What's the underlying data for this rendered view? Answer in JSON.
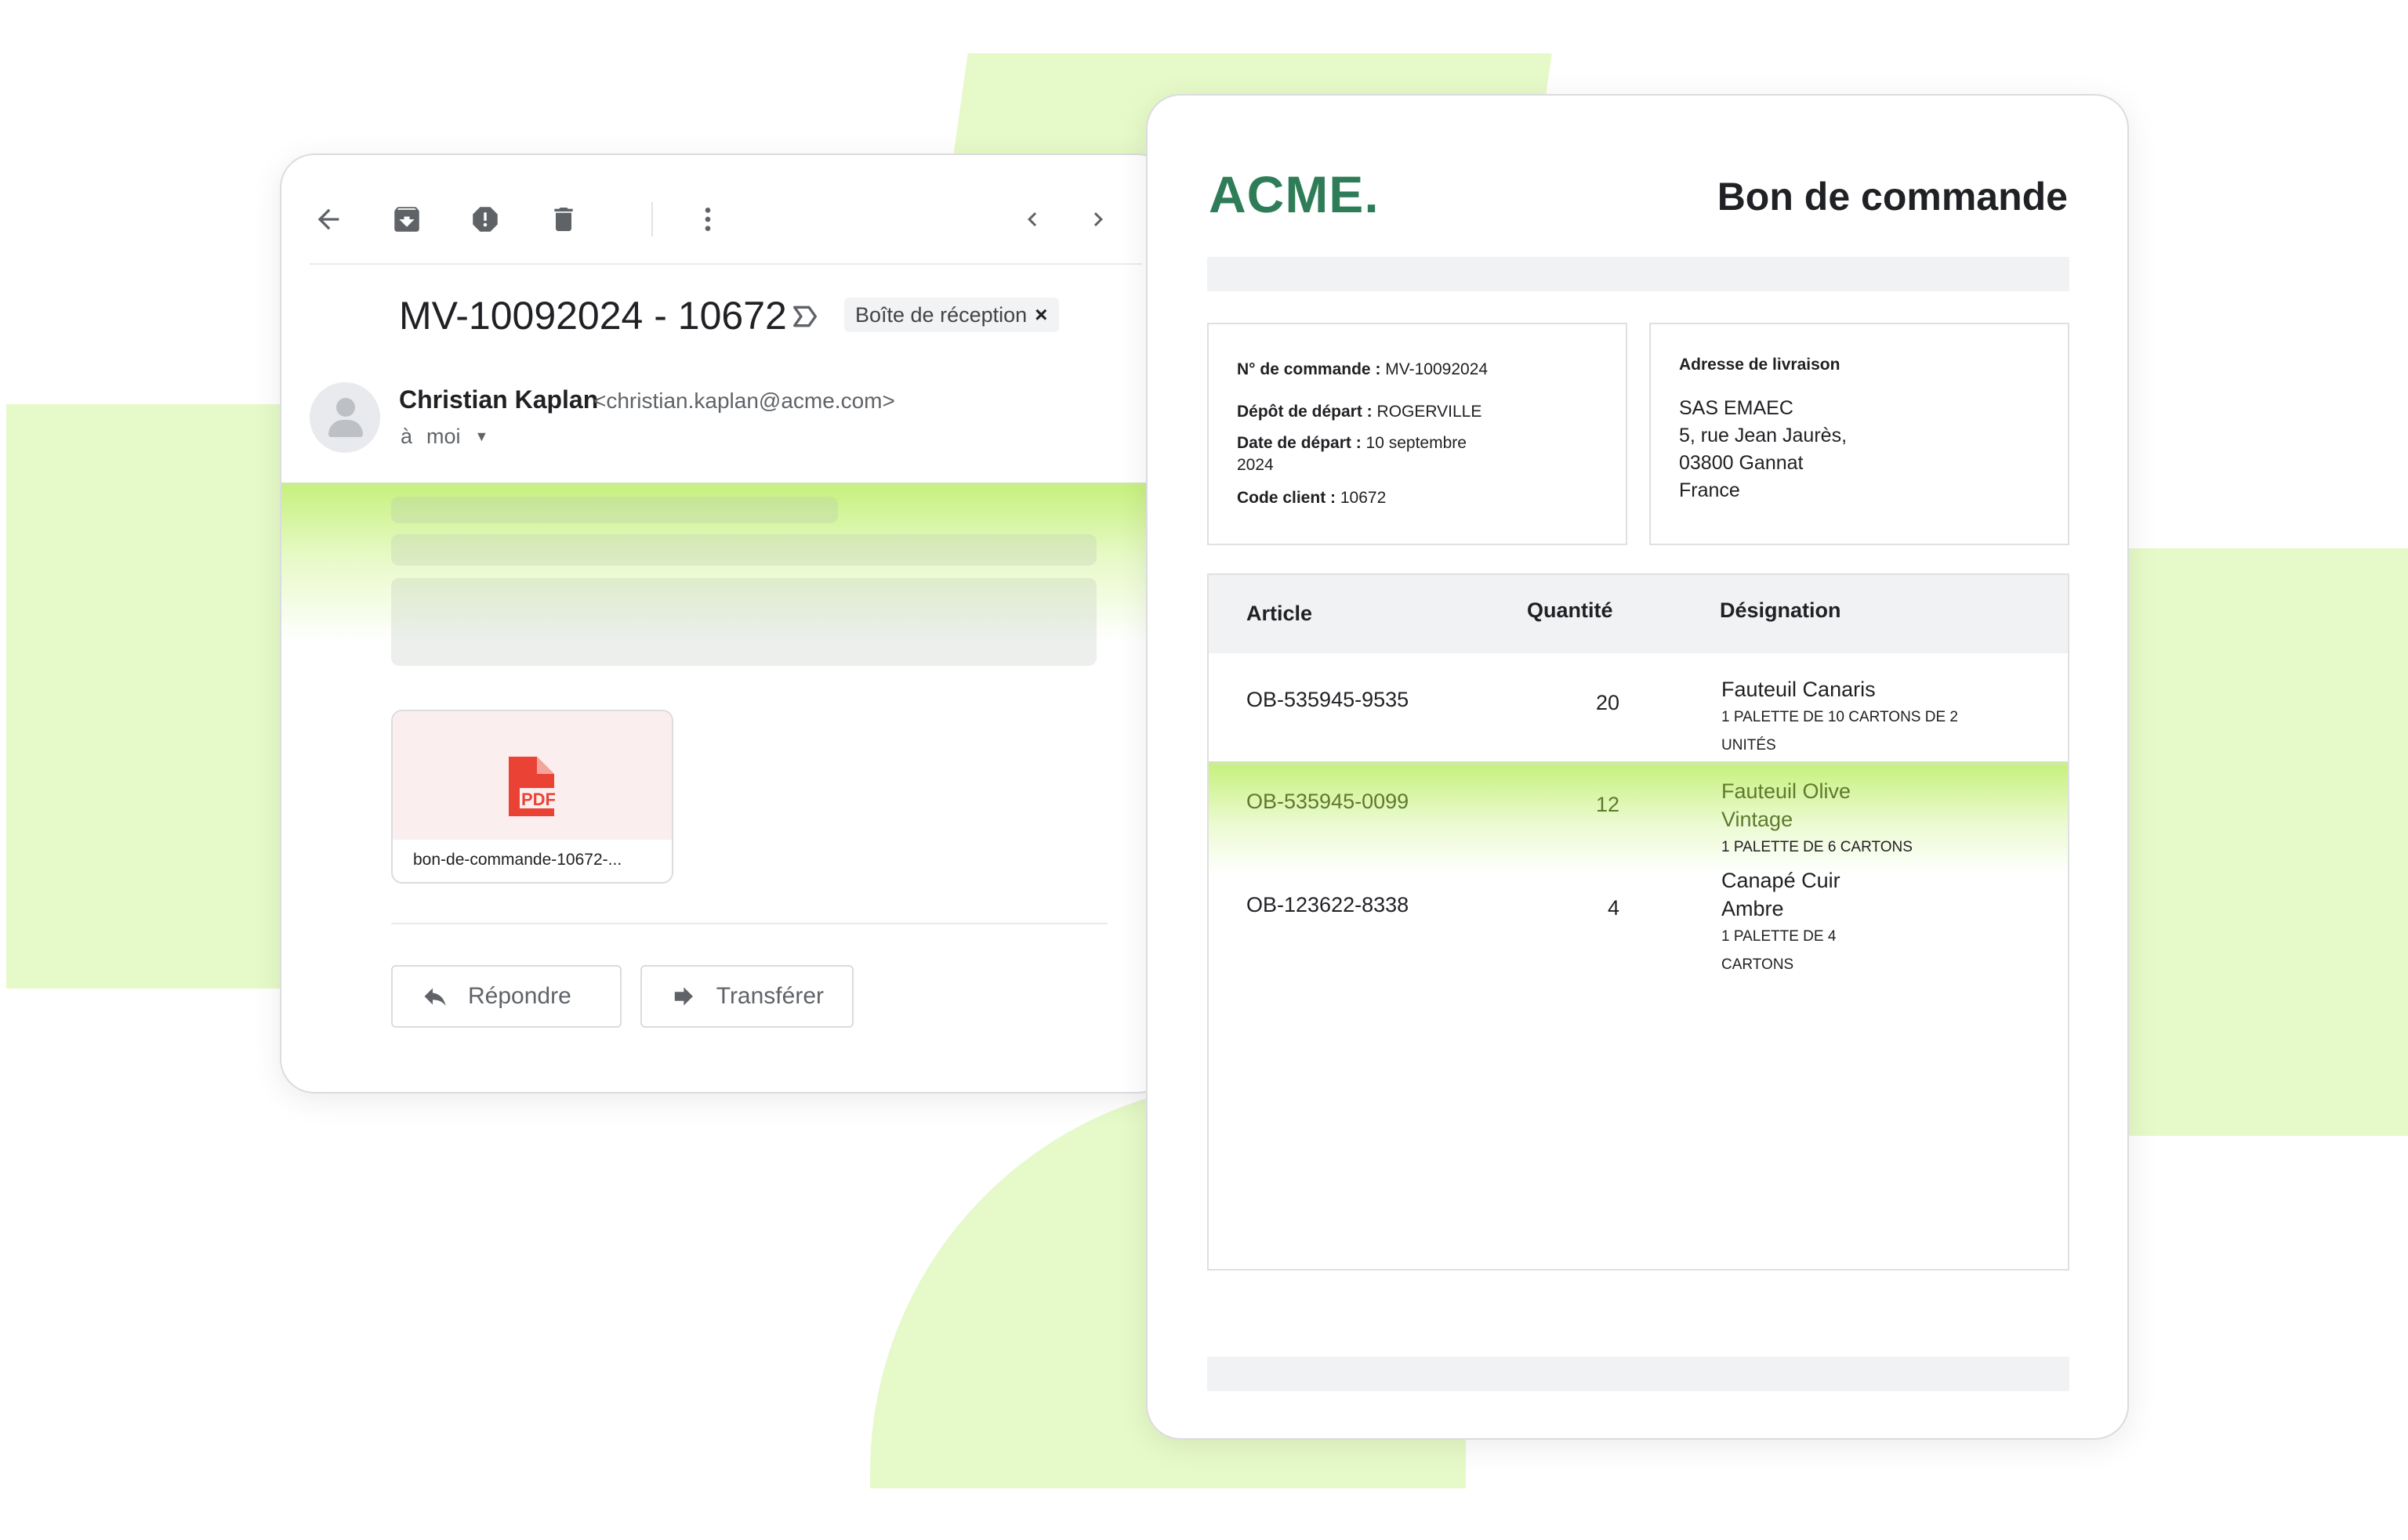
{
  "email": {
    "toolbar": {
      "back_icon": "arrow-left-icon",
      "archive_icon": "archive-icon",
      "spam_icon": "report-spam-icon",
      "delete_icon": "trash-icon",
      "more_icon": "more-vert-icon",
      "prev_icon": "chevron-left-icon",
      "next_icon": "chevron-right-icon"
    },
    "subject": "MV-10092024 - 10672",
    "label_chip": "Boîte de réception",
    "label_chip_close": "×",
    "sender": {
      "name": "Christian Kaplan",
      "email": "<christian.kaplan@acme.com>",
      "to_prefix": "à",
      "to_value": "moi"
    },
    "attachment": {
      "type_label": "PDF",
      "filename": "bon-de-commande-10672-..."
    },
    "actions": {
      "reply": "Répondre",
      "forward": "Transférer"
    }
  },
  "document": {
    "logo": "ACME.",
    "title": "Bon de commande",
    "order_info": {
      "order_number_label": "N° de commande :",
      "order_number": "MV-10092024",
      "depot_label": "Dépôt de départ :",
      "depot": "ROGERVILLE",
      "date_label": "Date de départ :",
      "date_line1": "10 septembre",
      "date_line2": "2024",
      "client_label": "Code client :",
      "client": "10672"
    },
    "delivery": {
      "title": "Adresse de livraison",
      "line1": "SAS EMAEC",
      "line2": "5, rue Jean Jaurès,",
      "line3": "03800 Gannat",
      "line4": "France"
    },
    "table": {
      "headers": {
        "article": "Article",
        "quantity": "Quantité",
        "designation": "Désignation"
      },
      "rows": [
        {
          "article": "OB-535945-9535",
          "quantity": "20",
          "name": "Fauteuil Canaris",
          "name2": "",
          "detail1": "1 PALETTE DE 10 CARTONS DE 2",
          "detail2": "UNITÉS"
        },
        {
          "article": "OB-535945-0099",
          "quantity": "12",
          "name": "Fauteuil Olive",
          "name2": "Vintage",
          "detail1": "1 PALETTE DE 6 CARTONS",
          "detail2": ""
        },
        {
          "article": "OB-123622-8338",
          "quantity": "4",
          "name": "Canapé Cuir",
          "name2": "Ambre",
          "detail1": "1 PALETTE DE 4",
          "detail2": "CARTONS"
        }
      ]
    }
  },
  "colors": {
    "accent_green": "#2e7d58",
    "highlight_green": "#c4f078",
    "background_shape": "#e6f9c8",
    "pdf_red": "#ea4335"
  }
}
